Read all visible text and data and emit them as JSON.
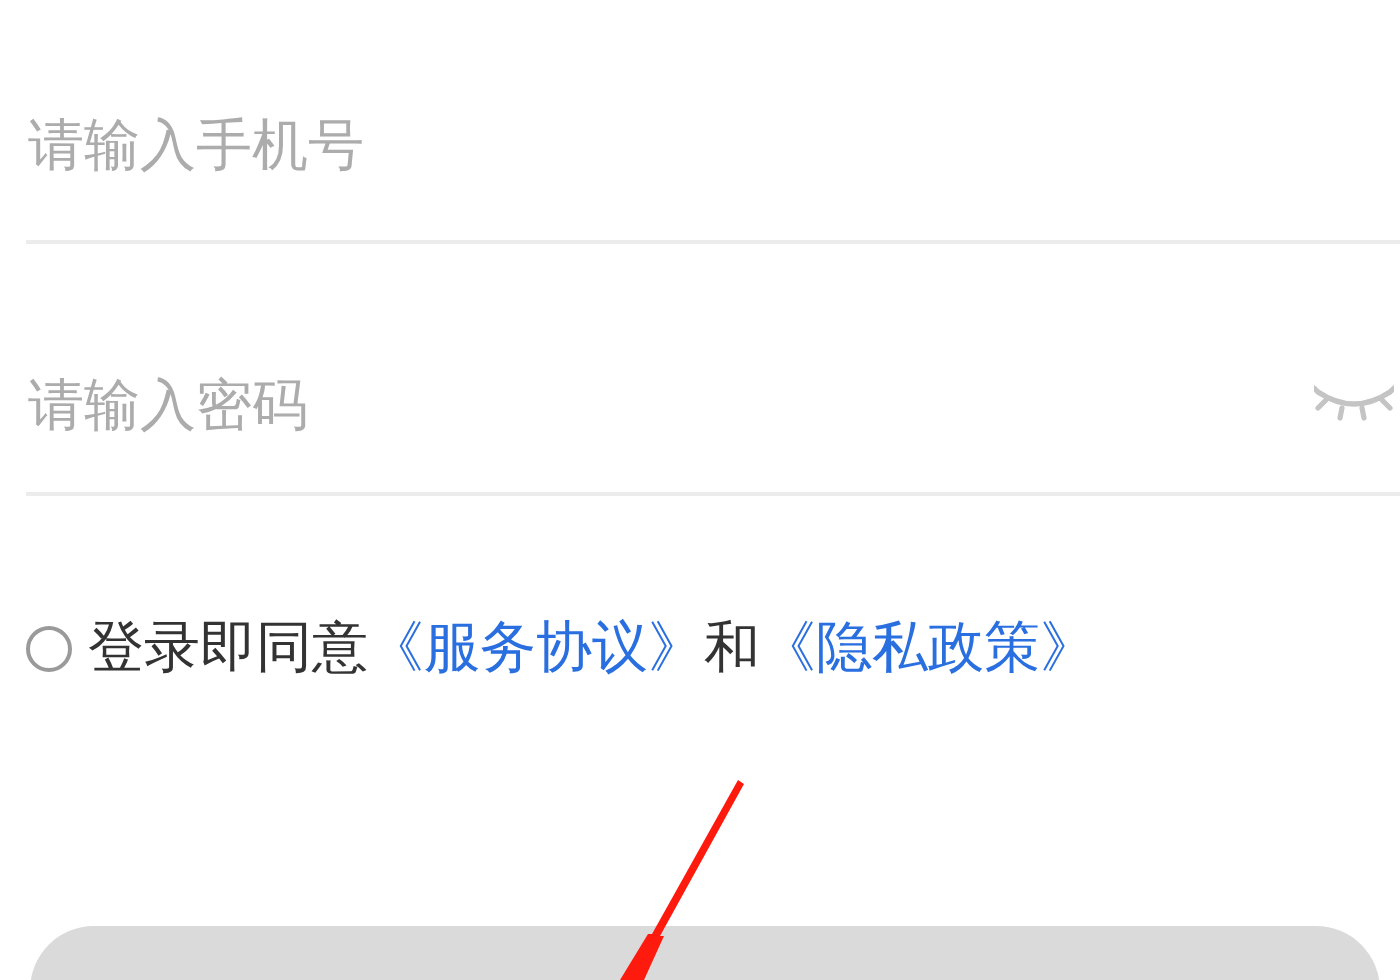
{
  "phone_field": {
    "placeholder": "请输入手机号"
  },
  "password_field": {
    "placeholder": "请输入密码",
    "revealed": false
  },
  "agreement": {
    "checked": false,
    "parts": [
      {
        "kind": "text",
        "text": "登录即同意"
      },
      {
        "kind": "link",
        "text": "《服务协议》"
      },
      {
        "kind": "text",
        "text": "和"
      },
      {
        "kind": "link",
        "text": "《隐私政策》"
      }
    ]
  },
  "login_button": {
    "disabled": true
  }
}
